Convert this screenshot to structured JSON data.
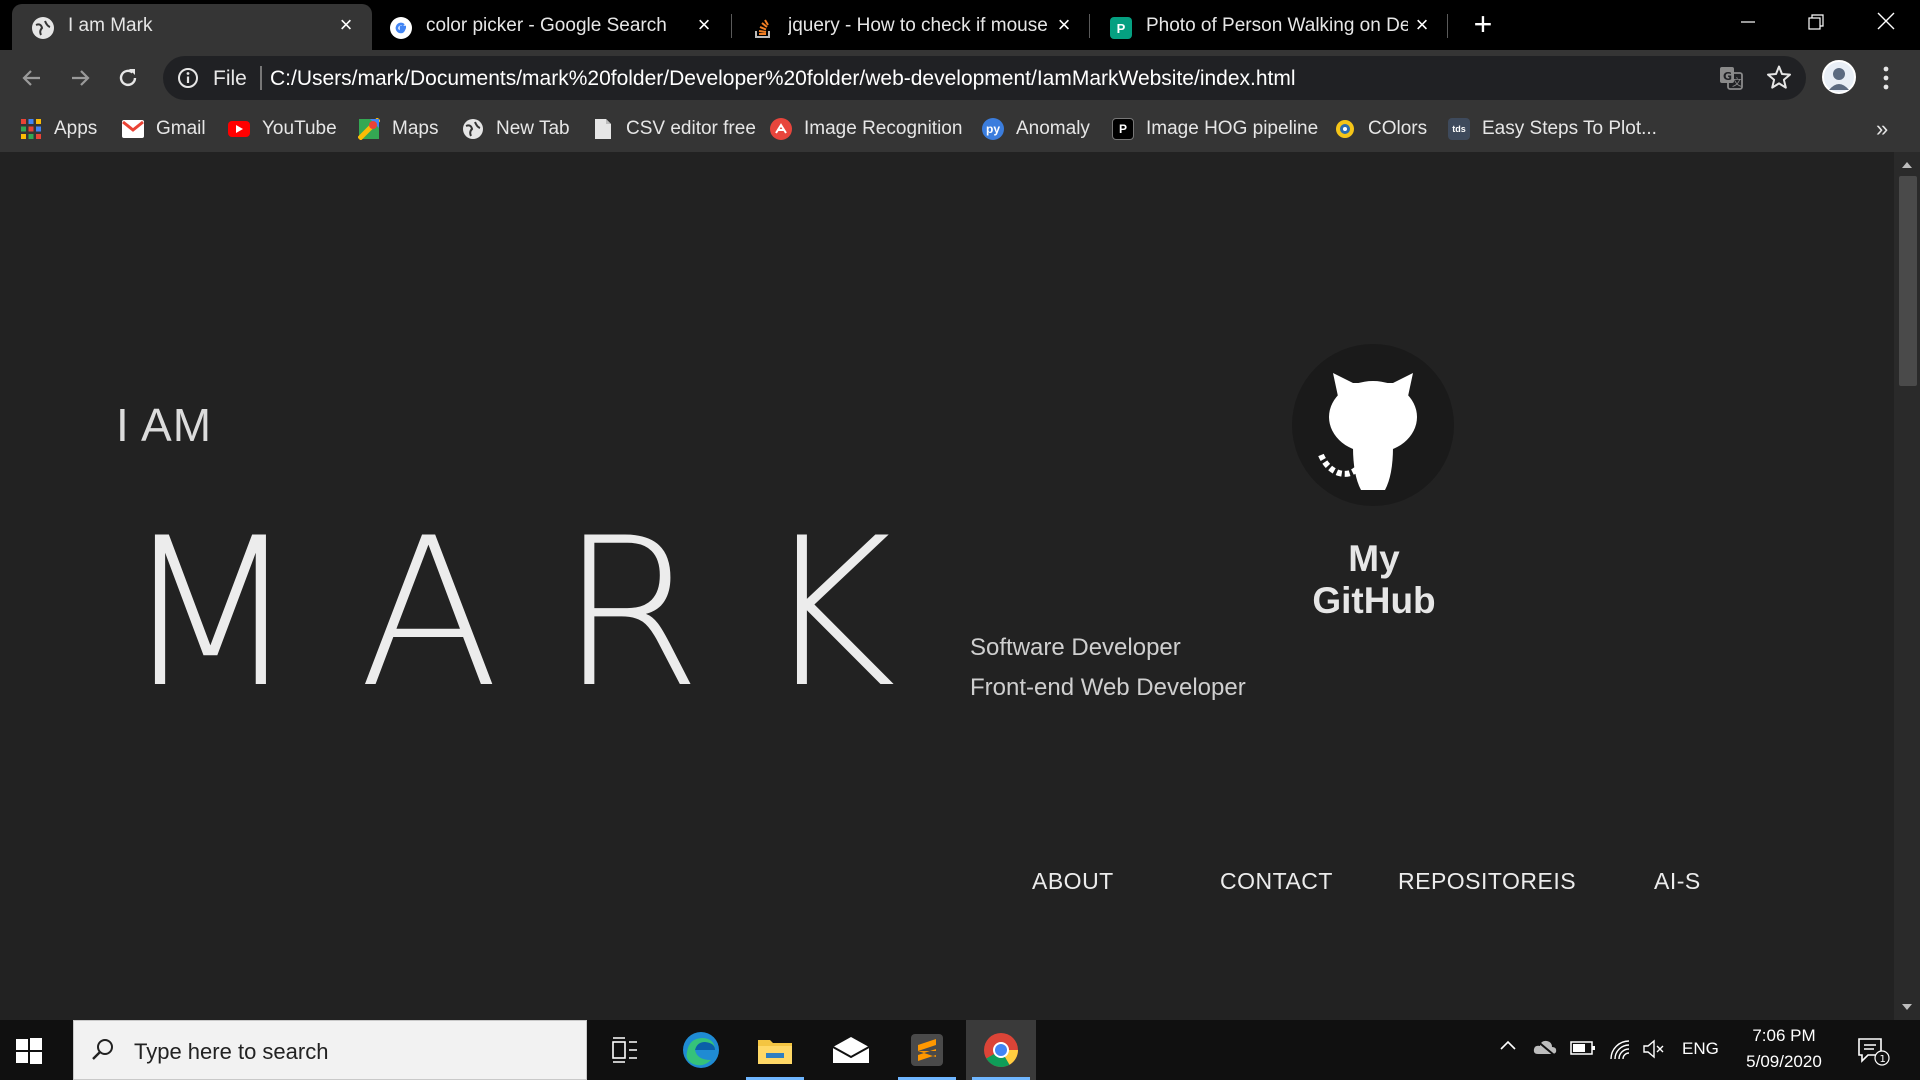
{
  "browser": {
    "tabs": [
      {
        "title": "I am Mark",
        "icon": "globe-icon",
        "active": true
      },
      {
        "title": "color picker - Google Search",
        "icon": "google-icon",
        "active": false
      },
      {
        "title": "jquery - How to check if mouse is",
        "icon": "stackoverflow-icon",
        "active": false
      },
      {
        "title": "Photo of Person Walking on Dese",
        "icon": "pexels-icon",
        "active": false
      }
    ],
    "address": {
      "scheme_label": "File",
      "url": "C:/Users/mark/Documents/mark%20folder/Developer%20folder/web-development/IamMarkWebsite/index.html"
    },
    "bookmarks": [
      {
        "label": "Apps",
        "icon": "apps-grid-icon"
      },
      {
        "label": "Gmail",
        "icon": "gmail-icon"
      },
      {
        "label": "YouTube",
        "icon": "youtube-icon"
      },
      {
        "label": "Maps",
        "icon": "maps-icon"
      },
      {
        "label": "New Tab",
        "icon": "globe-icon"
      },
      {
        "label": "CSV editor free",
        "icon": "document-icon"
      },
      {
        "label": "Image Recognition",
        "icon": "image-recognition-icon"
      },
      {
        "label": "Anomaly",
        "icon": "anomaly-icon"
      },
      {
        "label": "Image HOG pipeline",
        "icon": "p-icon"
      },
      {
        "label": "COlors",
        "icon": "colors-icon"
      },
      {
        "label": "Easy Steps To Plot...",
        "icon": "tds-icon"
      }
    ],
    "more_bookmarks": "»"
  },
  "page": {
    "intro": "I AM",
    "name": "MARK",
    "github_label": "My GitHub",
    "roles": [
      "Software Developer",
      "Front-end Web Developer"
    ],
    "nav": [
      "ABOUT",
      "CONTACT",
      "REPOSITOREIS",
      "AI-S"
    ]
  },
  "taskbar": {
    "search_placeholder": "Type here to search",
    "language": "ENG",
    "time": "7:06 PM",
    "date": "5/09/2020",
    "notification_count": "1"
  },
  "colors": {
    "page_bg": "#222222",
    "tab_strip_bg": "#000000",
    "toolbar_bg": "#353535",
    "text_light": "#ececec"
  }
}
